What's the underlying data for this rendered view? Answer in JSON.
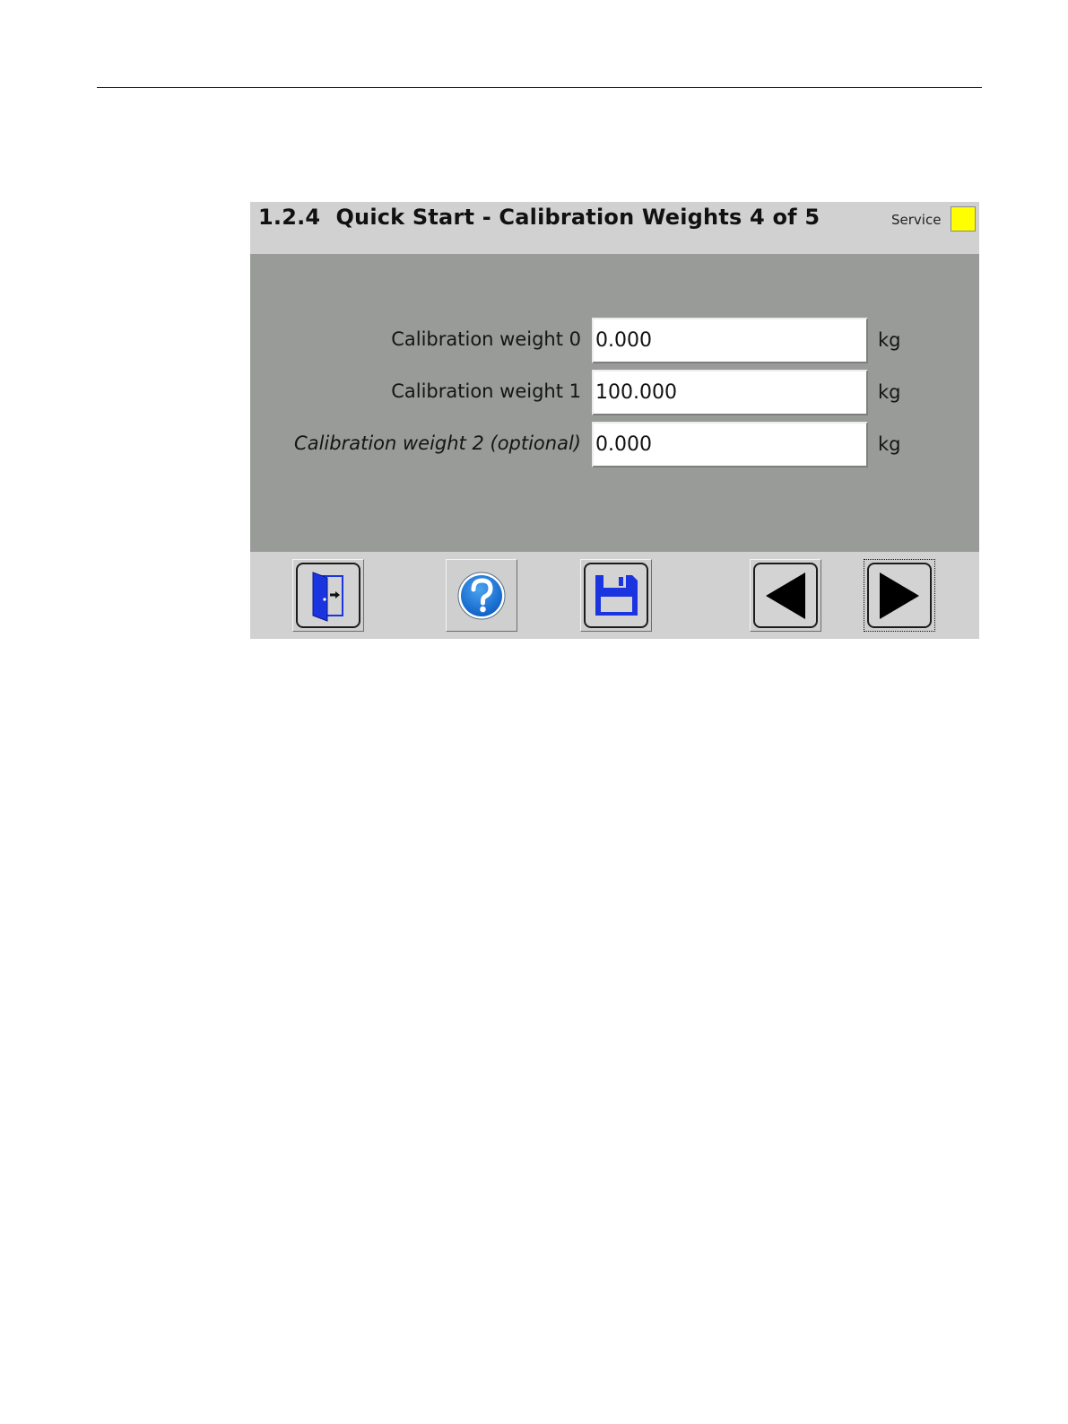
{
  "screen": {
    "title": "1.2.4  Quick Start - Calibration Weights 4 of 5",
    "service_label": "Service",
    "service_indicator_color": "#ffff00"
  },
  "fields": [
    {
      "label": "Calibration weight 0",
      "value": "0.000",
      "unit": "kg"
    },
    {
      "label": "Calibration weight 1",
      "value": "100.000",
      "unit": "kg"
    },
    {
      "label": "Calibration weight 2 (optional)",
      "value": "0.000",
      "unit": "kg"
    }
  ],
  "toolbar": {
    "exit_icon": "exit-door-icon",
    "help_icon": "help-question-icon",
    "save_icon": "save-floppy-icon",
    "previous_icon": "arrow-left-icon",
    "next_icon": "arrow-right-icon",
    "accent_color": "#1a35e0"
  }
}
